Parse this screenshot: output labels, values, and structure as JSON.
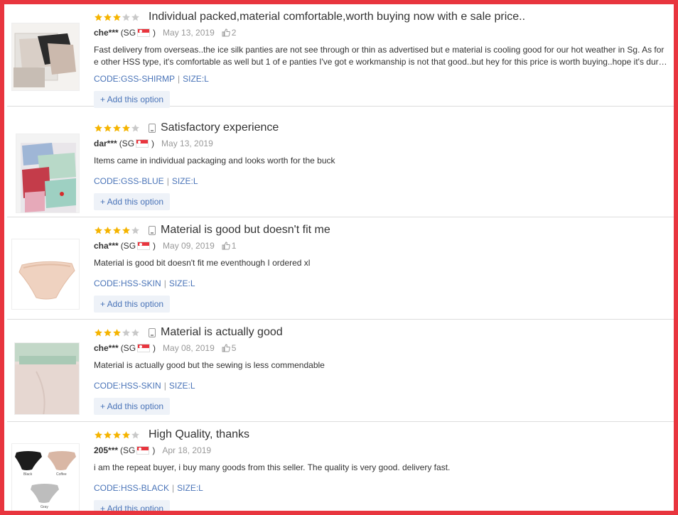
{
  "colors": {
    "frame": "#e8353e",
    "star": "#f5b400",
    "star_empty": "#c9c9c9",
    "link": "#4a74b8"
  },
  "reviews": [
    {
      "stars": 3,
      "has_phone": false,
      "title": "Individual packed,material comfortable,worth buying now with e sale price..",
      "user": "che***",
      "country": "(SG",
      "country_close": ")",
      "date": "May 13, 2019",
      "likes": "2",
      "text": "Fast delivery from overseas..the ice silk panties are not see through or thin as advertised but e material is cooling good for our hot weather in Sg. As for e other HSS type, it's comfortable as well but 1 of e panties I've got e workmanship is not that good..but hey for this price is worth buying..hope it's dur…",
      "code": "CODE:GSS-SHIRMP",
      "size": "SIZE:L",
      "add_label": "+ Add this option"
    },
    {
      "stars": 4,
      "has_phone": true,
      "title": "Satisfactory experience",
      "user": "dar***",
      "country": "(SG",
      "country_close": ")",
      "date": "May 13, 2019",
      "likes": "",
      "text": "Items came in individual packaging and looks worth for the buck",
      "code": "CODE:GSS-BLUE",
      "size": "SIZE:L",
      "add_label": "+ Add this option"
    },
    {
      "stars": 4,
      "has_phone": true,
      "title": "Material is good but doesn't fit me",
      "user": "cha***",
      "country": "(SG",
      "country_close": ")",
      "date": "May 09, 2019",
      "likes": "1",
      "text": "Material is good bit doesn't fit me eventhough I ordered xl",
      "code": "CODE:HSS-SKIN",
      "size": "SIZE:L",
      "add_label": "+ Add this option"
    },
    {
      "stars": 3,
      "has_phone": true,
      "title": "Material is actually good",
      "user": "che***",
      "country": "(SG",
      "country_close": ")",
      "date": "May 08, 2019",
      "likes": "5",
      "text": "Material is actually good but the sewing is less commendable",
      "code": "CODE:HSS-SKIN",
      "size": "SIZE:L",
      "add_label": "+ Add this option"
    },
    {
      "stars": 4,
      "has_phone": false,
      "title": "High Quality, thanks",
      "user": "205***",
      "country": "(SG",
      "country_close": ")",
      "date": "Apr 18, 2019",
      "likes": "",
      "text": "i am the repeat buyer, i buy many goods from this seller. The quality is very good. delivery fast.",
      "code": "CODE:HSS-BLACK",
      "size": "SIZE:L",
      "add_label": "+ Add this option",
      "photo_labels": [
        "Black",
        "Coffee",
        "Gray"
      ]
    }
  ]
}
